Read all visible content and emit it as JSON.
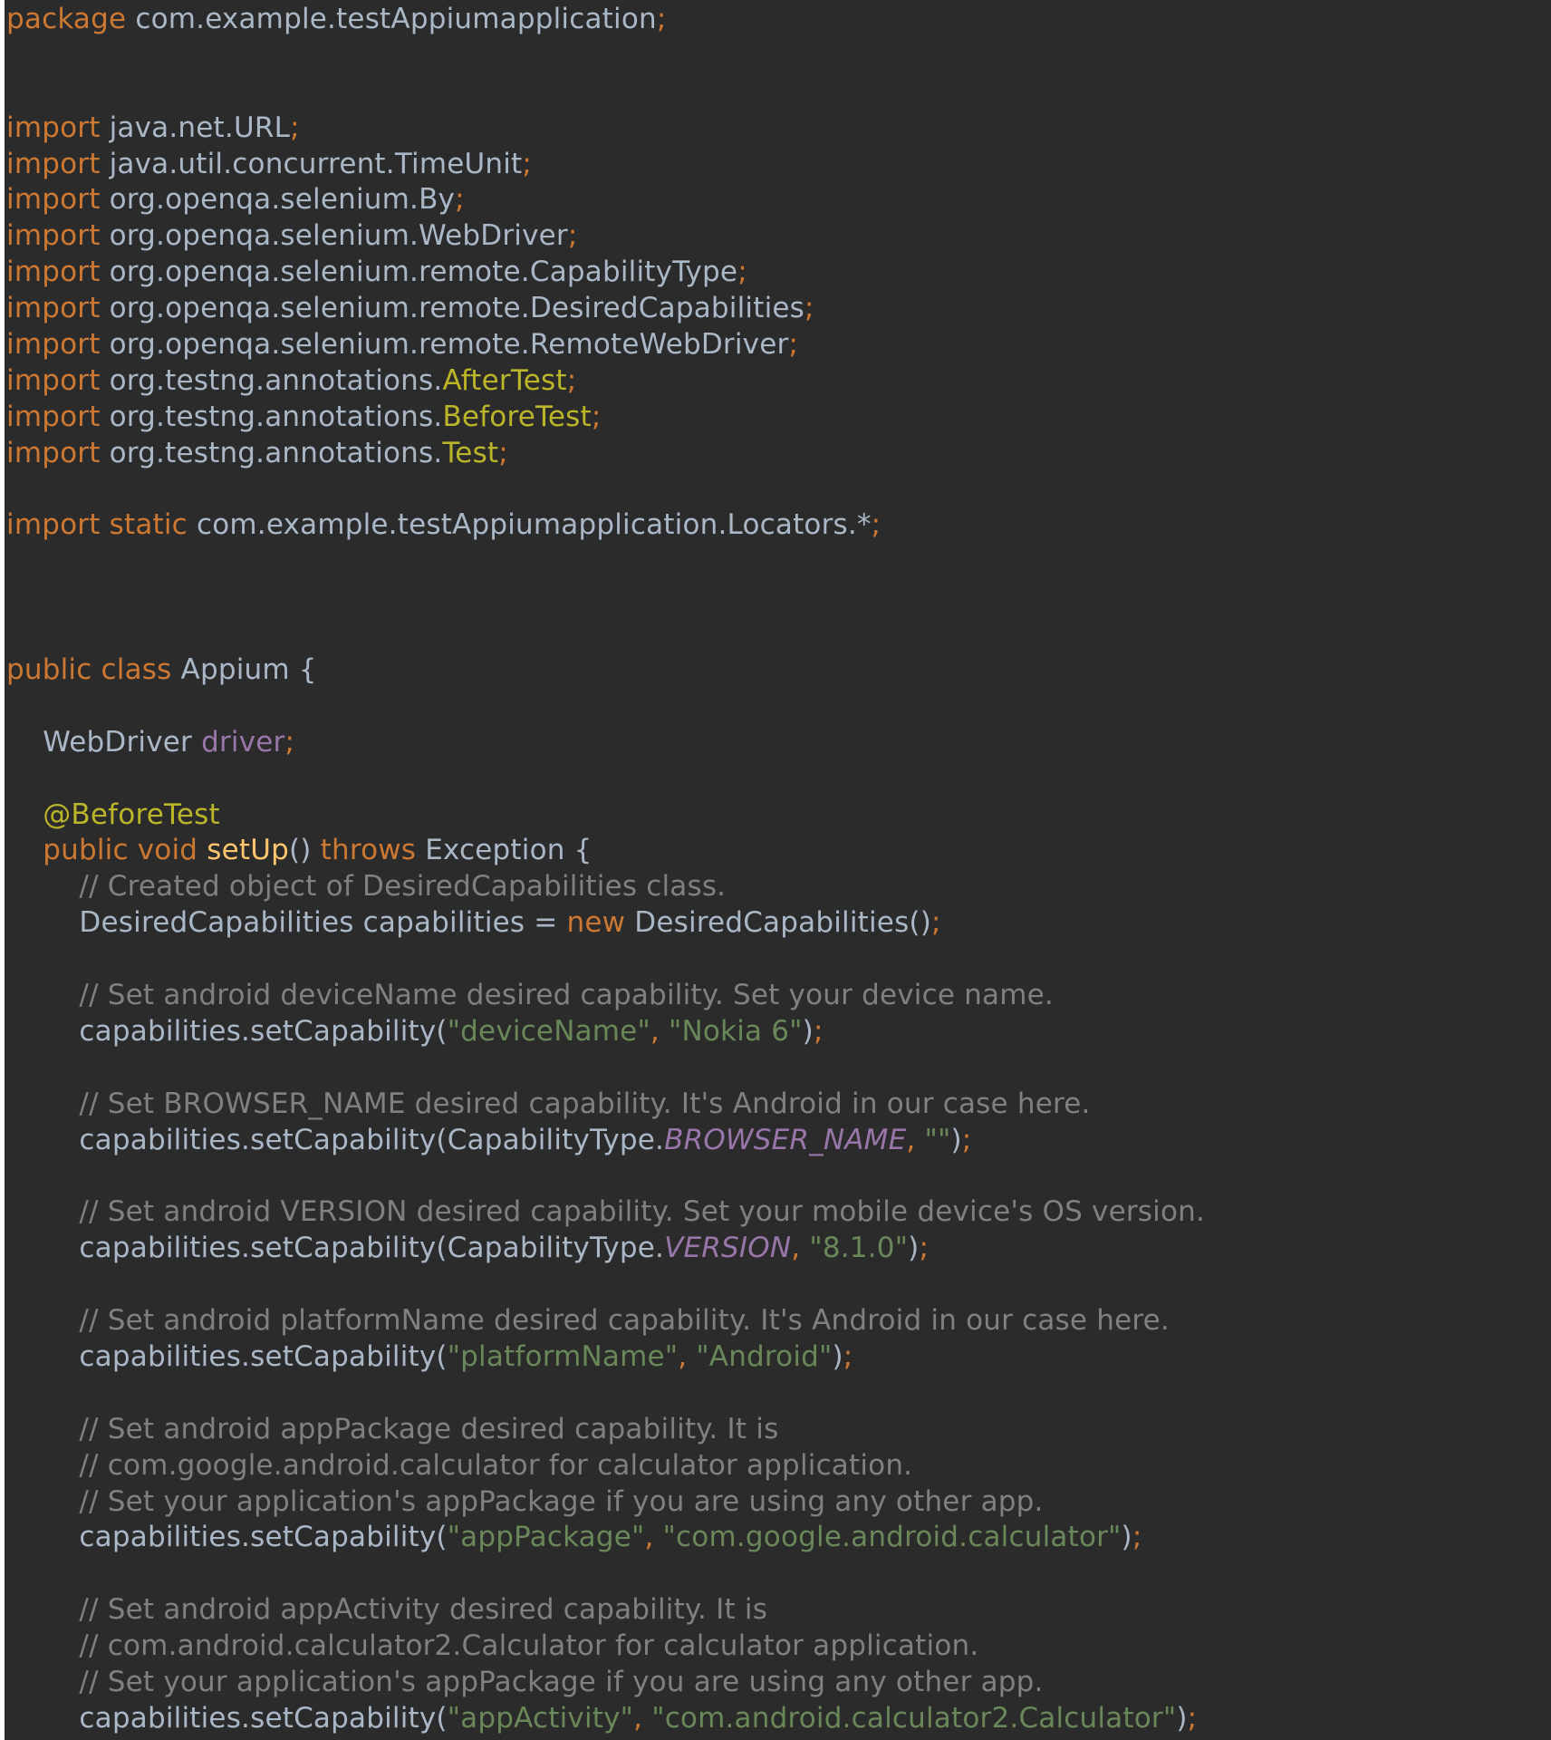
{
  "editor": {
    "language": "java",
    "theme_colors": {
      "background": "#2b2b2b",
      "default": "#a9b7c6",
      "keyword": "#cc7832",
      "annotation": "#bbb529",
      "comment": "#808080",
      "string": "#6a8759",
      "field": "#9876aa",
      "method": "#ffc66d"
    },
    "lines": [
      [
        {
          "t": "package",
          "c": "kw"
        },
        {
          "t": " com.example.testAppiumapplication",
          "c": "pl"
        },
        {
          "t": ";",
          "c": "kw"
        }
      ],
      [],
      [],
      [
        {
          "t": "import",
          "c": "kw"
        },
        {
          "t": " java.net.URL",
          "c": "pl"
        },
        {
          "t": ";",
          "c": "kw"
        }
      ],
      [
        {
          "t": "import",
          "c": "kw"
        },
        {
          "t": " java.util.concurrent.TimeUnit",
          "c": "pl"
        },
        {
          "t": ";",
          "c": "kw"
        }
      ],
      [
        {
          "t": "import",
          "c": "kw"
        },
        {
          "t": " org.openqa.selenium.By",
          "c": "pl"
        },
        {
          "t": ";",
          "c": "kw"
        }
      ],
      [
        {
          "t": "import",
          "c": "kw"
        },
        {
          "t": " org.openqa.selenium.WebDriver",
          "c": "pl"
        },
        {
          "t": ";",
          "c": "kw"
        }
      ],
      [
        {
          "t": "import",
          "c": "kw"
        },
        {
          "t": " org.openqa.selenium.remote.CapabilityType",
          "c": "pl"
        },
        {
          "t": ";",
          "c": "kw"
        }
      ],
      [
        {
          "t": "import",
          "c": "kw"
        },
        {
          "t": " org.openqa.selenium.remote.DesiredCapabilities",
          "c": "pl"
        },
        {
          "t": ";",
          "c": "kw"
        }
      ],
      [
        {
          "t": "import",
          "c": "kw"
        },
        {
          "t": " org.openqa.selenium.remote.RemoteWebDriver",
          "c": "pl"
        },
        {
          "t": ";",
          "c": "kw"
        }
      ],
      [
        {
          "t": "import",
          "c": "kw"
        },
        {
          "t": " org.testng.annotations.",
          "c": "pl"
        },
        {
          "t": "AfterTest",
          "c": "ann"
        },
        {
          "t": ";",
          "c": "kw"
        }
      ],
      [
        {
          "t": "import",
          "c": "kw"
        },
        {
          "t": " org.testng.annotations.",
          "c": "pl"
        },
        {
          "t": "BeforeTest",
          "c": "ann"
        },
        {
          "t": ";",
          "c": "kw"
        }
      ],
      [
        {
          "t": "import",
          "c": "kw"
        },
        {
          "t": " org.testng.annotations.",
          "c": "pl"
        },
        {
          "t": "Test",
          "c": "ann"
        },
        {
          "t": ";",
          "c": "kw"
        }
      ],
      [],
      [
        {
          "t": "import static",
          "c": "kw"
        },
        {
          "t": " com.example.testAppiumapplication.Locators.*",
          "c": "pl"
        },
        {
          "t": ";",
          "c": "kw"
        }
      ],
      [],
      [],
      [],
      [
        {
          "t": "public class",
          "c": "kw"
        },
        {
          "t": " Appium {",
          "c": "pl"
        }
      ],
      [],
      [
        {
          "t": "    WebDriver ",
          "c": "pl"
        },
        {
          "t": "driver",
          "c": "fld"
        },
        {
          "t": ";",
          "c": "kw"
        }
      ],
      [],
      [
        {
          "t": "    ",
          "c": "pl"
        },
        {
          "t": "@BeforeTest",
          "c": "ann"
        }
      ],
      [
        {
          "t": "    ",
          "c": "pl"
        },
        {
          "t": "public void",
          "c": "kw"
        },
        {
          "t": " ",
          "c": "pl"
        },
        {
          "t": "setUp",
          "c": "fn"
        },
        {
          "t": "() ",
          "c": "pl"
        },
        {
          "t": "throws",
          "c": "kw"
        },
        {
          "t": " Exception {",
          "c": "pl"
        }
      ],
      [
        {
          "t": "        // Created object of DesiredCapabilities class.",
          "c": "cm"
        }
      ],
      [
        {
          "t": "        DesiredCapabilities capabilities = ",
          "c": "pl"
        },
        {
          "t": "new",
          "c": "kw"
        },
        {
          "t": " DesiredCapabilities()",
          "c": "pl"
        },
        {
          "t": ";",
          "c": "kw"
        }
      ],
      [],
      [
        {
          "t": "        // Set android deviceName desired capability. Set your device name.",
          "c": "cm"
        }
      ],
      [
        {
          "t": "        capabilities.setCapability(",
          "c": "pl"
        },
        {
          "t": "\"deviceName\"",
          "c": "st"
        },
        {
          "t": ", ",
          "c": "kw"
        },
        {
          "t": "\"Nokia 6\"",
          "c": "st"
        },
        {
          "t": ")",
          "c": "pl"
        },
        {
          "t": ";",
          "c": "kw"
        }
      ],
      [],
      [
        {
          "t": "        // Set BROWSER_NAME desired capability. It's Android in our case here.",
          "c": "cm"
        }
      ],
      [
        {
          "t": "        capabilities.setCapability(CapabilityType.",
          "c": "pl"
        },
        {
          "t": "BROWSER_NAME",
          "c": "cst"
        },
        {
          "t": ", ",
          "c": "kw"
        },
        {
          "t": "\"\"",
          "c": "st"
        },
        {
          "t": ")",
          "c": "pl"
        },
        {
          "t": ";",
          "c": "kw"
        }
      ],
      [],
      [
        {
          "t": "        // Set android VERSION desired capability. Set your mobile device's OS version.",
          "c": "cm"
        }
      ],
      [
        {
          "t": "        capabilities.setCapability(CapabilityType.",
          "c": "pl"
        },
        {
          "t": "VERSION",
          "c": "cst"
        },
        {
          "t": ", ",
          "c": "kw"
        },
        {
          "t": "\"8.1.0\"",
          "c": "st"
        },
        {
          "t": ")",
          "c": "pl"
        },
        {
          "t": ";",
          "c": "kw"
        }
      ],
      [],
      [
        {
          "t": "        // Set android platformName desired capability. It's Android in our case here.",
          "c": "cm"
        }
      ],
      [
        {
          "t": "        capabilities.setCapability(",
          "c": "pl"
        },
        {
          "t": "\"platformName\"",
          "c": "st"
        },
        {
          "t": ", ",
          "c": "kw"
        },
        {
          "t": "\"Android\"",
          "c": "st"
        },
        {
          "t": ")",
          "c": "pl"
        },
        {
          "t": ";",
          "c": "kw"
        }
      ],
      [],
      [
        {
          "t": "        // Set android appPackage desired capability. It is",
          "c": "cm"
        }
      ],
      [
        {
          "t": "        // com.google.android.calculator for calculator application.",
          "c": "cm"
        }
      ],
      [
        {
          "t": "        // Set your application's appPackage if you are using any other app.",
          "c": "cm"
        }
      ],
      [
        {
          "t": "        capabilities.setCapability(",
          "c": "pl"
        },
        {
          "t": "\"appPackage\"",
          "c": "st"
        },
        {
          "t": ", ",
          "c": "kw"
        },
        {
          "t": "\"com.google.android.calculator\"",
          "c": "st"
        },
        {
          "t": ")",
          "c": "pl"
        },
        {
          "t": ";",
          "c": "kw"
        }
      ],
      [],
      [
        {
          "t": "        // Set android appActivity desired capability. It is",
          "c": "cm"
        }
      ],
      [
        {
          "t": "        // com.android.calculator2.Calculator for calculator application.",
          "c": "cm"
        }
      ],
      [
        {
          "t": "        // Set your application's appPackage if you are using any other app.",
          "c": "cm"
        }
      ],
      [
        {
          "t": "        capabilities.setCapability(",
          "c": "pl"
        },
        {
          "t": "\"appActivity\"",
          "c": "st"
        },
        {
          "t": ", ",
          "c": "kw"
        },
        {
          "t": "\"com.android.calculator2.Calculator\"",
          "c": "st"
        },
        {
          "t": ")",
          "c": "pl"
        },
        {
          "t": ";",
          "c": "kw"
        }
      ]
    ]
  }
}
